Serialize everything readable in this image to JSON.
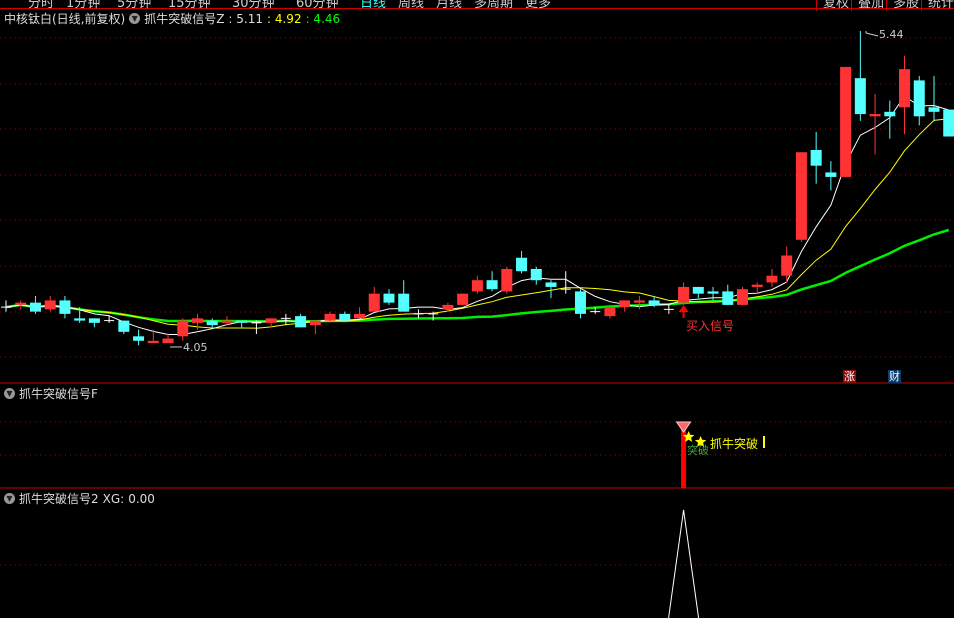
{
  "toolbar": {
    "periods": [
      "分时",
      "1分钟",
      "5分钟",
      "15分钟",
      "30分钟",
      "60分钟",
      "日线",
      "周线",
      "月线",
      "多周期",
      "更多"
    ],
    "active": "日线",
    "right": [
      "复权",
      "叠加",
      "多股",
      "统计"
    ]
  },
  "main": {
    "stock": "中核钛白(日线,前复权)",
    "indicator": "抓牛突破信号Z",
    "v1": ": 5.11",
    "v2": ": 4.92",
    "v3": ": 4.46",
    "high_label": "5.44",
    "low_label": "4.05",
    "buy_signal": "买入信号",
    "badge_zhang": "涨",
    "badge_cai": "财"
  },
  "pane2": {
    "title": "抓牛突破信号F",
    "signal_text": "抓牛突破",
    "signal_sub": "突破"
  },
  "pane3": {
    "title": "抓牛突破信号2",
    "xg_label": "XG:",
    "xg_value": "0.00"
  },
  "colors": {
    "up": "#ff3333",
    "down": "#54ffff",
    "ma1": "#ffffff",
    "ma2": "#ffff00",
    "ma3": "#00ee00",
    "grid": "#aa0000"
  },
  "chart_data": {
    "type": "candlestick",
    "price_range": [
      4.05,
      5.44
    ],
    "candles": [
      [
        4.21,
        4.24,
        4.19,
        4.21
      ],
      [
        4.22,
        4.24,
        4.2,
        4.23
      ],
      [
        4.23,
        4.26,
        4.18,
        4.19
      ],
      [
        4.2,
        4.26,
        4.19,
        4.24
      ],
      [
        4.24,
        4.26,
        4.16,
        4.18
      ],
      [
        4.16,
        4.21,
        4.14,
        4.15
      ],
      [
        4.16,
        4.16,
        4.12,
        4.14
      ],
      [
        4.15,
        4.17,
        4.14,
        4.15
      ],
      [
        4.15,
        4.15,
        4.09,
        4.1
      ],
      [
        4.08,
        4.11,
        4.04,
        4.06
      ],
      [
        4.05,
        4.11,
        4.05,
        4.06
      ],
      [
        4.05,
        4.09,
        4.05,
        4.07
      ],
      [
        4.08,
        4.16,
        4.06,
        4.15
      ],
      [
        4.14,
        4.18,
        4.11,
        4.16
      ],
      [
        4.15,
        4.16,
        4.12,
        4.13
      ],
      [
        4.14,
        4.17,
        4.13,
        4.15
      ],
      [
        4.15,
        4.15,
        4.12,
        4.14
      ],
      [
        4.14,
        4.15,
        4.09,
        4.14
      ],
      [
        4.14,
        4.16,
        4.12,
        4.16
      ],
      [
        4.16,
        4.18,
        4.13,
        4.16
      ],
      [
        4.17,
        4.18,
        4.12,
        4.12
      ],
      [
        4.13,
        4.15,
        4.09,
        4.15
      ],
      [
        4.15,
        4.19,
        4.14,
        4.18
      ],
      [
        4.18,
        4.19,
        4.15,
        4.15
      ],
      [
        4.16,
        4.21,
        4.16,
        4.18
      ],
      [
        4.19,
        4.3,
        4.19,
        4.27
      ],
      [
        4.27,
        4.29,
        4.22,
        4.23
      ],
      [
        4.27,
        4.33,
        4.19,
        4.19
      ],
      [
        4.18,
        4.2,
        4.16,
        4.18
      ],
      [
        4.18,
        4.19,
        4.15,
        4.18
      ],
      [
        4.2,
        4.23,
        4.19,
        4.22
      ],
      [
        4.22,
        4.27,
        4.22,
        4.27
      ],
      [
        4.28,
        4.35,
        4.27,
        4.33
      ],
      [
        4.33,
        4.37,
        4.28,
        4.29
      ],
      [
        4.28,
        4.39,
        4.27,
        4.38
      ],
      [
        4.43,
        4.46,
        4.36,
        4.37
      ],
      [
        4.38,
        4.39,
        4.31,
        4.33
      ],
      [
        4.32,
        4.33,
        4.25,
        4.3
      ],
      [
        4.29,
        4.37,
        4.27,
        4.29
      ],
      [
        4.28,
        4.29,
        4.16,
        4.18
      ],
      [
        4.19,
        4.21,
        4.18,
        4.19
      ],
      [
        4.17,
        4.21,
        4.16,
        4.21
      ],
      [
        4.21,
        4.24,
        4.19,
        4.24
      ],
      [
        4.23,
        4.26,
        4.2,
        4.24
      ],
      [
        4.24,
        4.26,
        4.21,
        4.22
      ],
      [
        4.2,
        4.22,
        4.18,
        4.2
      ],
      [
        4.23,
        4.32,
        4.22,
        4.3
      ],
      [
        4.3,
        4.3,
        4.25,
        4.27
      ],
      [
        4.28,
        4.3,
        4.24,
        4.27
      ],
      [
        4.28,
        4.31,
        4.22,
        4.22
      ],
      [
        4.22,
        4.3,
        4.22,
        4.29
      ],
      [
        4.3,
        4.32,
        4.27,
        4.31
      ],
      [
        4.32,
        4.38,
        4.3,
        4.35
      ],
      [
        4.35,
        4.48,
        4.32,
        4.44
      ],
      [
        4.51,
        4.9,
        4.5,
        4.9
      ],
      [
        4.91,
        4.99,
        4.76,
        4.84
      ],
      [
        4.81,
        4.86,
        4.73,
        4.79
      ],
      [
        4.79,
        5.28,
        4.79,
        5.28
      ],
      [
        5.23,
        5.44,
        5.04,
        5.07
      ],
      [
        5.06,
        5.16,
        4.89,
        5.07
      ],
      [
        5.08,
        5.13,
        4.96,
        5.06
      ],
      [
        5.1,
        5.33,
        4.98,
        5.27
      ],
      [
        5.22,
        5.24,
        5.02,
        5.06
      ],
      [
        5.1,
        5.24,
        5.04,
        5.08
      ],
      [
        5.09,
        5.09,
        4.97,
        4.97
      ]
    ],
    "buy_signal_index": 46,
    "ma_periods": [
      5,
      10,
      30
    ]
  }
}
